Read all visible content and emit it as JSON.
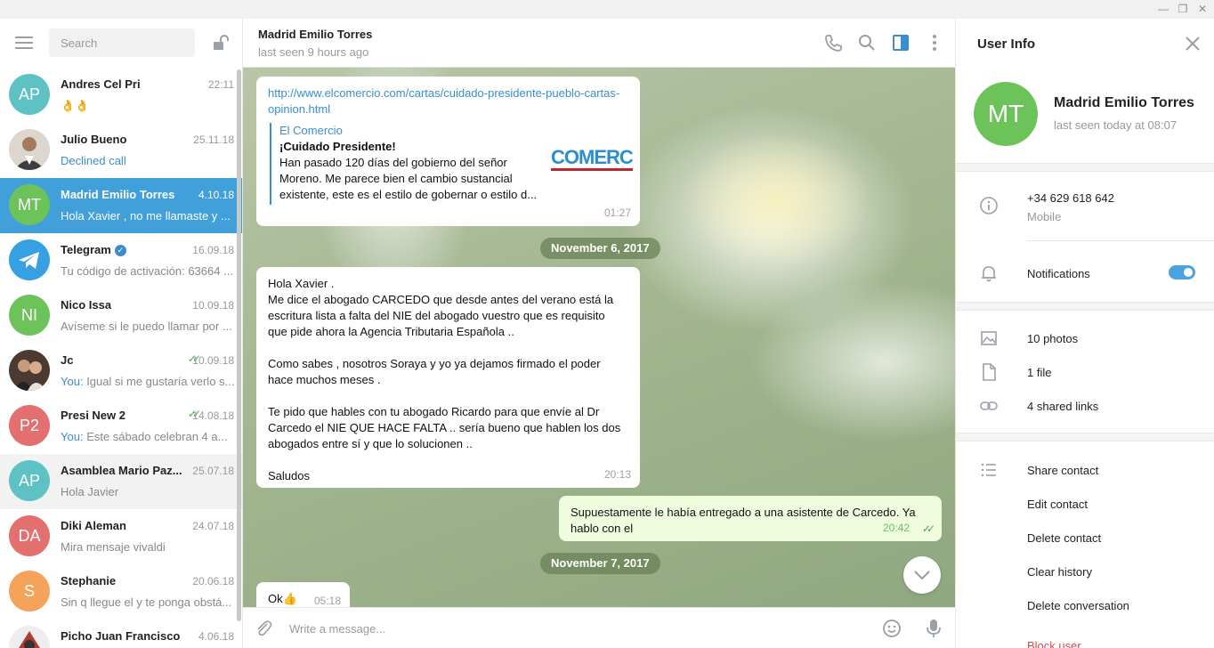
{
  "window": {
    "minimize": "—",
    "restore": "❐",
    "close": "✕"
  },
  "sidebar": {
    "search_placeholder": "Search",
    "chats": [
      {
        "name": "Andres Cel Pri",
        "initials": "AP",
        "date": "22:11",
        "preview": "👌👌",
        "avatar_color": "#5ec2c5"
      },
      {
        "name": "Julio Bueno",
        "initials": "",
        "date": "25.11.18",
        "preview": "Declined call",
        "avatar_color": "#c9b7a4"
      },
      {
        "name": "Madrid Emilio Torres",
        "initials": "MT",
        "date": "4.10.18",
        "preview": "Hola Xavier , no me llamaste y ...",
        "avatar_color": "#6cc35a"
      },
      {
        "name": "Telegram",
        "initials": "",
        "date": "16.09.18",
        "preview": "Tu código de activación: 63664 ...",
        "avatar_color": "#36a0e2"
      },
      {
        "name": "Nico Issa",
        "initials": "NI",
        "date": "10.09.18",
        "preview": "Avíseme si le puedo llamar por ...",
        "avatar_color": "#6cc35a"
      },
      {
        "name": "Jc",
        "initials": "",
        "date": "10.09.18",
        "you": "You:",
        "preview": "Igual si me gustaría verlo s...",
        "avatar_color": "#6d5a4a"
      },
      {
        "name": "Presi New 2",
        "initials": "P2",
        "date": "14.08.18",
        "you": "You:",
        "preview": "Este sábado celebran 4 a...",
        "avatar_color": "#e36f6f"
      },
      {
        "name": "Asamblea Mario Paz...",
        "initials": "AP",
        "date": "25.07.18",
        "preview": "Hola Javier",
        "avatar_color": "#5ec2c5"
      },
      {
        "name": "Diki Aleman",
        "initials": "DA",
        "date": "24.07.18",
        "preview": "Mira mensaje vivaldi",
        "avatar_color": "#e36f6f"
      },
      {
        "name": "Stephanie",
        "initials": "S",
        "date": "20.06.18",
        "preview": "Sin q llegue el y te ponga obstá...",
        "avatar_color": "#f5a25b"
      },
      {
        "name": "Picho Juan Francisco",
        "initials": "",
        "date": "4.06.18",
        "preview": "",
        "avatar_color": "#b03b2e"
      }
    ]
  },
  "chat": {
    "peer_name": "Madrid Emilio Torres",
    "peer_status": "last seen 9 hours ago",
    "messages": {
      "link_url": "http://www.elcomercio.com/cartas/cuidado-presidente-pueblo-cartas-opinion.html",
      "preview_site": "El Comercio",
      "preview_title": "¡Cuidado Presidente!",
      "preview_desc": "Han pasado 120 días del gobierno del señor Moreno. Me parece bien el cambio sustancial existente, este es el estilo de gobernar o estilo d...",
      "preview_logo": "COMERC",
      "link_time": "01:27",
      "date1": "November 6, 2017",
      "in_msg_lines": [
        "Hola Xavier .",
        "Me dice el abogado CARCEDO que desde antes del verano está la",
        "escritura lista a falta del NIE del abogado vuestro que es requisito",
        "que pide ahora la Agencia Tributaria Española ..",
        "",
        "Como sabes , nosotros Soraya y yo ya dejamos firmado el poder",
        "hace muchos meses .",
        "",
        "Te pido que hables con tu abogado Ricardo para que envíe al Dr",
        "Carcedo el NIE QUE HACE FALTA .. sería bueno que hablen los dos",
        "abogados entre sí y que lo solucionen ..",
        "",
        "Saludos"
      ],
      "in_msg_time": "20:13",
      "out_msg_lines": [
        "Supuestamente le había entregado a una asistente de Carcedo. Ya",
        "hablo con el"
      ],
      "out_msg_time": "20:42",
      "date2": "November 7, 2017",
      "last_msg": "Ok👍",
      "last_time": "05:18"
    },
    "input_placeholder": "Write a message..."
  },
  "info": {
    "title": "User Info",
    "initials": "MT",
    "name": "Madrid Emilio Torres",
    "last_seen": "last seen today at 08:07",
    "phone": "+34 629 618 642",
    "phone_label": "Mobile",
    "notifications_label": "Notifications",
    "notifications_on": true,
    "media": {
      "photos": "10 photos",
      "files": "1 file",
      "links": "4 shared links"
    },
    "actions": {
      "share": "Share contact",
      "edit": "Edit contact",
      "delete": "Delete contact",
      "clear": "Clear history",
      "delete_conv": "Delete conversation",
      "block": "Block user"
    }
  },
  "colors": {
    "accent": "#419fd9",
    "out_bubble": "#effdde",
    "check": "#4fae4e"
  }
}
